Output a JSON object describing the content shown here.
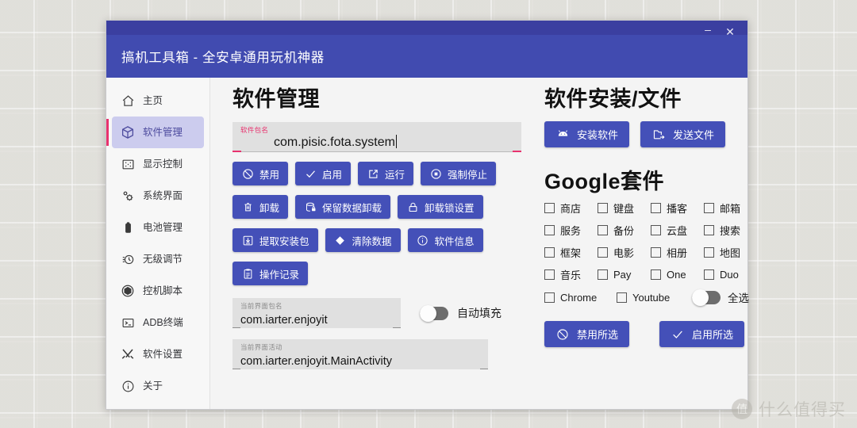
{
  "window": {
    "title": "搞机工具箱 - 全安卓通用玩机神器",
    "minimize_label": "–",
    "close_label": "✕",
    "accent_blue": "#414bb0",
    "accent_pink": "#e8326e",
    "button_blue": "#4450b8"
  },
  "sidebar": {
    "items": [
      {
        "label": "主页",
        "icon": "home-icon",
        "active": false
      },
      {
        "label": "软件管理",
        "icon": "package-icon",
        "active": true
      },
      {
        "label": "显示控制",
        "icon": "display-icon",
        "active": false
      },
      {
        "label": "系统界面",
        "icon": "gear-icon",
        "active": false
      },
      {
        "label": "电池管理",
        "icon": "battery-icon",
        "active": false
      },
      {
        "label": "无级调节",
        "icon": "clock-icon",
        "active": false
      },
      {
        "label": "控机脚本",
        "icon": "hexagon-icon",
        "active": false
      },
      {
        "label": "ADB终端",
        "icon": "terminal-icon",
        "active": false
      },
      {
        "label": "软件设置",
        "icon": "tools-icon",
        "active": false
      },
      {
        "label": "关于",
        "icon": "info-icon",
        "active": false
      }
    ]
  },
  "left_panel": {
    "title": "软件管理",
    "package_field": {
      "label": "软件包名",
      "value": "com.pisic.fota.system"
    },
    "buttons_row1": [
      {
        "label": "禁用",
        "icon": "ban-icon"
      },
      {
        "label": "启用",
        "icon": "check-icon"
      },
      {
        "label": "运行",
        "icon": "external-link-icon"
      },
      {
        "label": "强制停止",
        "icon": "stop-circle-icon"
      }
    ],
    "buttons_row2": [
      {
        "label": "卸载",
        "icon": "trash-icon"
      },
      {
        "label": "保留数据卸载",
        "icon": "database-lock-icon"
      },
      {
        "label": "卸载锁设置",
        "icon": "lock-icon"
      }
    ],
    "buttons_row3": [
      {
        "label": "提取安装包",
        "icon": "download-box-icon"
      },
      {
        "label": "清除数据",
        "icon": "eraser-icon"
      },
      {
        "label": "软件信息",
        "icon": "info-circle-icon"
      }
    ],
    "buttons_row4": [
      {
        "label": "操作记录",
        "icon": "clipboard-icon"
      }
    ],
    "current_package_field": {
      "label": "当前界面包名",
      "value": "com.iarter.enjoyit"
    },
    "current_activity_field": {
      "label": "当前界面活动",
      "value": "com.iarter.enjoyit.MainActivity"
    },
    "autofill_toggle": {
      "label": "自动填充",
      "state": "off"
    }
  },
  "right_panel": {
    "install_title": "软件安装/文件",
    "install_buttons": [
      {
        "label": "安装软件",
        "icon": "android-icon"
      },
      {
        "label": "发送文件",
        "icon": "folder-send-icon"
      }
    ],
    "google_title": "Google套件",
    "checkbox_rows": [
      [
        {
          "label": "商店",
          "checked": false
        },
        {
          "label": "键盘",
          "checked": false
        },
        {
          "label": "播客",
          "checked": false
        },
        {
          "label": "邮箱",
          "checked": false
        }
      ],
      [
        {
          "label": "服务",
          "checked": false
        },
        {
          "label": "备份",
          "checked": false
        },
        {
          "label": "云盘",
          "checked": false
        },
        {
          "label": "搜索",
          "checked": false
        }
      ],
      [
        {
          "label": "框架",
          "checked": false
        },
        {
          "label": "电影",
          "checked": false
        },
        {
          "label": "相册",
          "checked": false
        },
        {
          "label": "地图",
          "checked": false
        }
      ],
      [
        {
          "label": "音乐",
          "checked": false
        },
        {
          "label": "Pay",
          "checked": false
        },
        {
          "label": "One",
          "checked": false
        },
        {
          "label": "Duo",
          "checked": false
        }
      ]
    ],
    "last_row": [
      {
        "label": "Chrome",
        "checked": false
      },
      {
        "label": "Youtube",
        "checked": false
      }
    ],
    "select_all_toggle": {
      "label": "全选",
      "state": "off"
    },
    "action_buttons": [
      {
        "label": "禁用所选",
        "icon": "ban-icon"
      },
      {
        "label": "启用所选",
        "icon": "check-icon"
      }
    ]
  },
  "watermark": {
    "logo_char": "值",
    "text": "什么值得买"
  }
}
